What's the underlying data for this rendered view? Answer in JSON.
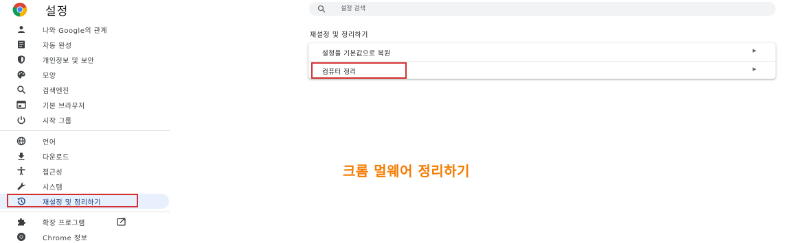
{
  "header": {
    "title": "설정"
  },
  "search": {
    "placeholder": "설정 검색"
  },
  "sidebar": {
    "items": [
      {
        "label": "나와 Google의 관계",
        "icon": "person-icon"
      },
      {
        "label": "자동 완성",
        "icon": "autofill-icon"
      },
      {
        "label": "개인정보 및 보안",
        "icon": "shield-icon"
      },
      {
        "label": "모양",
        "icon": "palette-icon"
      },
      {
        "label": "검색엔진",
        "icon": "search-icon"
      },
      {
        "label": "기본 브라우저",
        "icon": "browser-icon"
      },
      {
        "label": "시작 그룹",
        "icon": "power-icon"
      },
      {
        "label": "언어",
        "icon": "globe-icon"
      },
      {
        "label": "다운로드",
        "icon": "download-icon"
      },
      {
        "label": "접근성",
        "icon": "accessibility-icon"
      },
      {
        "label": "시스템",
        "icon": "wrench-icon"
      },
      {
        "label": "재설정 및 정리하기",
        "icon": "restore-icon",
        "active": true
      },
      {
        "label": "확장 프로그램",
        "icon": "puzzle-icon"
      },
      {
        "label": "Chrome 정보",
        "icon": "chrome-icon"
      }
    ]
  },
  "main": {
    "section_title": "재설정 및 정리하기",
    "rows": [
      {
        "label": "설정을 기본값으로 복원"
      },
      {
        "label": "컴퓨터 정리"
      }
    ]
  },
  "annotation": "크롬 멀웨어 정리하기",
  "colors": {
    "active_bg": "#e8f0fe",
    "highlight": "#d32f2f",
    "annotation": "#f57c00"
  }
}
